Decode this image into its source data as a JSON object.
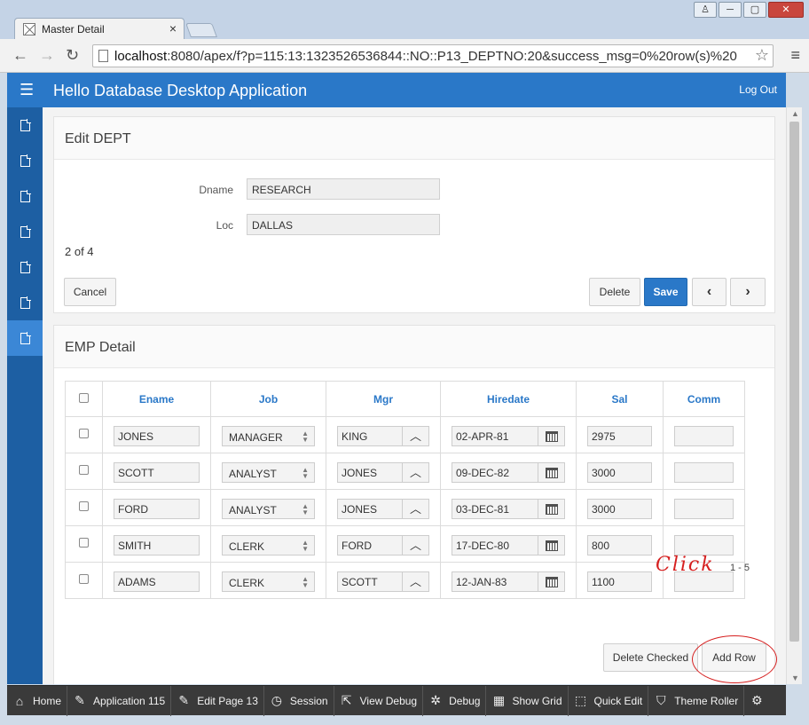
{
  "browser": {
    "tab_title": "Master Detail",
    "tab_close": "×",
    "url_host": "localhost",
    "url_rest": ":8080/apex/f?p=115:13:1323526536844::NO::P13_DEPTNO:20&success_msg=0%20row(s)%20",
    "window_buttons": [
      "♙",
      "─",
      "▢",
      "✕"
    ]
  },
  "app": {
    "title": "Hello Database Desktop Application",
    "logout": "Log Out"
  },
  "sidebar": {
    "items": 7,
    "active_index": 6
  },
  "edit_dept": {
    "title": "Edit DEPT",
    "dname_label": "Dname",
    "dname_value": "RESEARCH",
    "loc_label": "Loc",
    "loc_value": "DALLAS",
    "record_count": "2 of 4",
    "cancel": "Cancel",
    "delete": "Delete",
    "save": "Save",
    "prev": "‹",
    "next": "›"
  },
  "emp_detail": {
    "title": "EMP Detail",
    "columns": [
      "Ename",
      "Job",
      "Mgr",
      "Hiredate",
      "Sal",
      "Comm"
    ],
    "rows": [
      {
        "ename": "JONES",
        "job": "MANAGER",
        "mgr": "KING",
        "hiredate": "02-APR-81",
        "sal": "2975",
        "comm": ""
      },
      {
        "ename": "SCOTT",
        "job": "ANALYST",
        "mgr": "JONES",
        "hiredate": "09-DEC-82",
        "sal": "3000",
        "comm": ""
      },
      {
        "ename": "FORD",
        "job": "ANALYST",
        "mgr": "JONES",
        "hiredate": "03-DEC-81",
        "sal": "3000",
        "comm": ""
      },
      {
        "ename": "SMITH",
        "job": "CLERK",
        "mgr": "FORD",
        "hiredate": "17-DEC-80",
        "sal": "800",
        "comm": ""
      },
      {
        "ename": "ADAMS",
        "job": "CLERK",
        "mgr": "SCOTT",
        "hiredate": "12-JAN-83",
        "sal": "1100",
        "comm": ""
      }
    ],
    "pagination": "1 - 5",
    "delete_checked": "Delete Checked",
    "add_row": "Add Row",
    "annotation": "Click"
  },
  "devbar": {
    "items": [
      {
        "icon": "⌂",
        "label": "Home"
      },
      {
        "icon": "✎",
        "label": "Application 115"
      },
      {
        "icon": "✎",
        "label": "Edit Page 13"
      },
      {
        "icon": "◷",
        "label": "Session"
      },
      {
        "icon": "⇱",
        "label": "View Debug"
      },
      {
        "icon": "✲",
        "label": "Debug"
      },
      {
        "icon": "▦",
        "label": "Show Grid"
      },
      {
        "icon": "⬚",
        "label": "Quick Edit"
      },
      {
        "icon": "⛉",
        "label": "Theme Roller"
      },
      {
        "icon": "⚙",
        "label": ""
      }
    ]
  },
  "colors": {
    "accent": "#2a78c8",
    "sidebar": "#1d5fa3",
    "annotation": "#d62020"
  }
}
